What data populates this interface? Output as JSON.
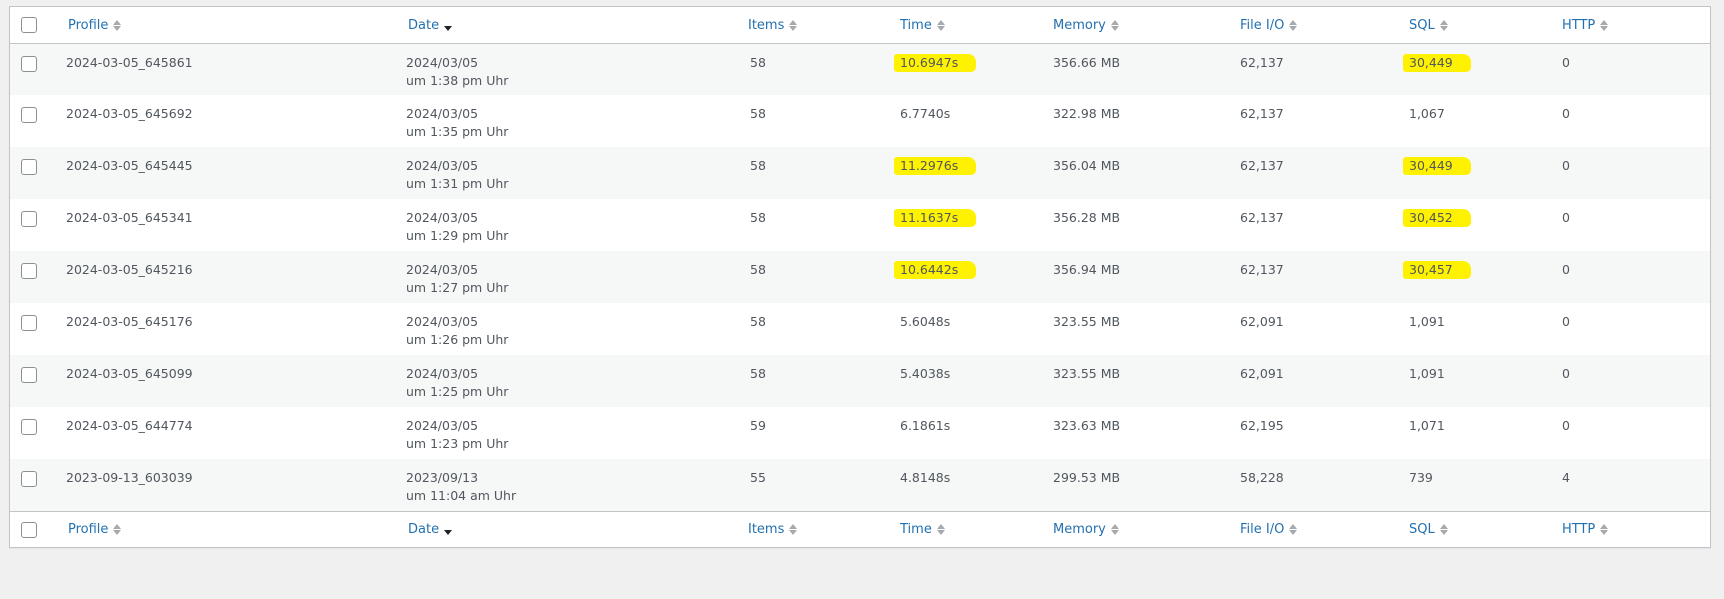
{
  "header": {
    "profile": "Profile",
    "date": "Date",
    "items": "Items",
    "time": "Time",
    "memory": "Memory",
    "file_io": "File I/O",
    "sql": "SQL",
    "http": "HTTP"
  },
  "highlight_color": "#fff200",
  "link_color": "#2271b1",
  "rows": [
    {
      "profile": "2024-03-05_645861",
      "date": "2024/03/05",
      "time_of_day": "um 1:38 pm Uhr",
      "items": "58",
      "time": "10.6947s",
      "memory": "356.66 MB",
      "file_io": "62,137",
      "sql": "30,449",
      "http": "0",
      "time_highlighted": true,
      "sql_highlighted": true
    },
    {
      "profile": "2024-03-05_645692",
      "date": "2024/03/05",
      "time_of_day": "um 1:35 pm Uhr",
      "items": "58",
      "time": "6.7740s",
      "memory": "322.98 MB",
      "file_io": "62,137",
      "sql": "1,067",
      "http": "0",
      "time_highlighted": false,
      "sql_highlighted": false
    },
    {
      "profile": "2024-03-05_645445",
      "date": "2024/03/05",
      "time_of_day": "um 1:31 pm Uhr",
      "items": "58",
      "time": "11.2976s",
      "memory": "356.04 MB",
      "file_io": "62,137",
      "sql": "30,449",
      "http": "0",
      "time_highlighted": true,
      "sql_highlighted": true
    },
    {
      "profile": "2024-03-05_645341",
      "date": "2024/03/05",
      "time_of_day": "um 1:29 pm Uhr",
      "items": "58",
      "time": "11.1637s",
      "memory": "356.28 MB",
      "file_io": "62,137",
      "sql": "30,452",
      "http": "0",
      "time_highlighted": true,
      "sql_highlighted": true
    },
    {
      "profile": "2024-03-05_645216",
      "date": "2024/03/05",
      "time_of_day": "um 1:27 pm Uhr",
      "items": "58",
      "time": "10.6442s",
      "memory": "356.94 MB",
      "file_io": "62,137",
      "sql": "30,457",
      "http": "0",
      "time_highlighted": true,
      "sql_highlighted": true
    },
    {
      "profile": "2024-03-05_645176",
      "date": "2024/03/05",
      "time_of_day": "um 1:26 pm Uhr",
      "items": "58",
      "time": "5.6048s",
      "memory": "323.55 MB",
      "file_io": "62,091",
      "sql": "1,091",
      "http": "0",
      "time_highlighted": false,
      "sql_highlighted": false
    },
    {
      "profile": "2024-03-05_645099",
      "date": "2024/03/05",
      "time_of_day": "um 1:25 pm Uhr",
      "items": "58",
      "time": "5.4038s",
      "memory": "323.55 MB",
      "file_io": "62,091",
      "sql": "1,091",
      "http": "0",
      "time_highlighted": false,
      "sql_highlighted": false
    },
    {
      "profile": "2024-03-05_644774",
      "date": "2024/03/05",
      "time_of_day": "um 1:23 pm Uhr",
      "items": "59",
      "time": "6.1861s",
      "memory": "323.63 MB",
      "file_io": "62,195",
      "sql": "1,071",
      "http": "0",
      "time_highlighted": false,
      "sql_highlighted": false
    },
    {
      "profile": "2023-09-13_603039",
      "date": "2023/09/13",
      "time_of_day": "um 11:04 am Uhr",
      "items": "55",
      "time": "4.8148s",
      "memory": "299.53 MB",
      "file_io": "58,228",
      "sql": "739",
      "http": "4",
      "time_highlighted": false,
      "sql_highlighted": false
    }
  ]
}
